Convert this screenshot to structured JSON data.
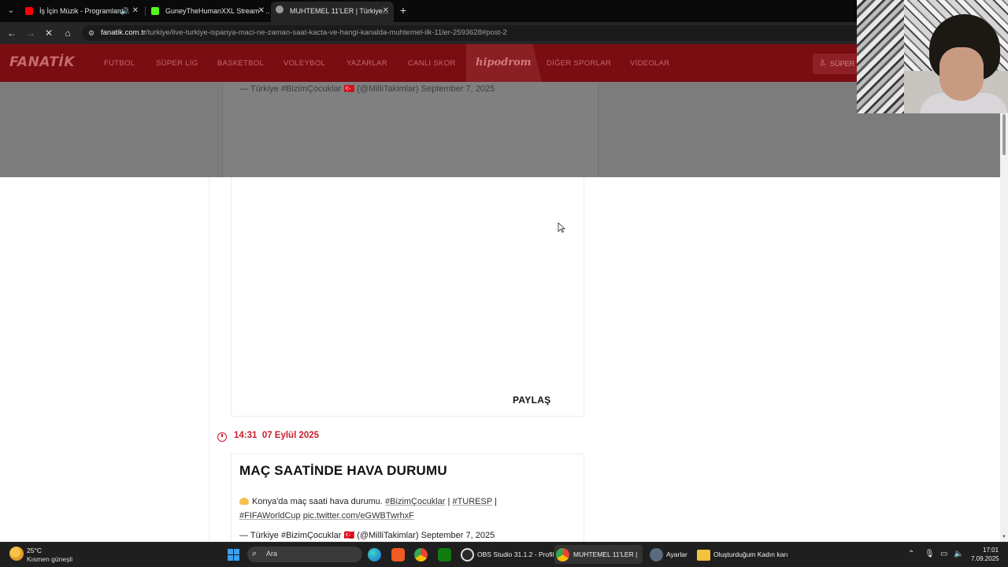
{
  "browser": {
    "tabs": [
      {
        "title": "İş İçin Müzik - Programlam...",
        "favicon_color": "#ff0000",
        "audio": true,
        "active": false
      },
      {
        "title": "GuneyTheHumanXXL Stream - ...",
        "favicon_color": "#53fc18",
        "audio": false,
        "active": false
      },
      {
        "title": "MUHTEMEL 11'LER | Türkiye...",
        "favicon_color": "#9a9a9a",
        "audio": false,
        "active": true
      }
    ],
    "new_tab_icon": "plus-icon",
    "url_host": "fanatik.com.tr",
    "url_path": "/turkiye/live-turkiye-ispanya-maci-ne-zaman-saat-kacta-ve-hangi-kanalda-muhtemel-ilk-11ler-2593628#post-2"
  },
  "site": {
    "logo": "FANATİK",
    "nav": [
      "FUTBOL",
      "SÜPER LİG",
      "BASKETBOL",
      "VOLEYBOL",
      "YAZARLAR",
      "CANLI SKOR"
    ],
    "hipodrom": "hipodrom",
    "nav_right": [
      "DİĞER SPORLAR",
      "VİDEOLAR"
    ],
    "super_button": "SÜPER",
    "brand_color": "#c81e2b"
  },
  "content": {
    "dim_quote": "— Türkiye #BizimÇocuklar 🇹🇷 (@MilliTakimlar) September 7, 2025",
    "share_label": "PAYLAŞ",
    "post_time": "14:31",
    "post_date": "07 Eylül 2025",
    "headline": "MAÇ SAATİNDE HAVA DURUMU",
    "body_text": "Konya'da maç saati hava durumu.",
    "body_tags_1": [
      "#BizimÇocuklar",
      "#TURESP"
    ],
    "body_tags_2": [
      "#FIFAWorldCup",
      "pic.twitter.com/eGWBTwrhxF"
    ],
    "separator": "|",
    "quote": "— Türkiye #BizimÇocuklar 🇹🇷 (@MilliTakimlar) September 7, 2025"
  },
  "taskbar": {
    "weather_temp": "25°C",
    "weather_desc": "Kısmen güneşli",
    "search_label": "Ara",
    "apps": [
      {
        "label": "OBS Studio 31.1.2 - Profil",
        "icon": "obs-icon"
      },
      {
        "label": "MUHTEMEL 11'LER |",
        "icon": "chrome-icon"
      },
      {
        "label": "Ayarlar",
        "icon": "gear-icon"
      },
      {
        "label": "Oluşturduğum Kadın karı",
        "icon": "folder-icon"
      }
    ],
    "time": "17:01",
    "date": "7.09.2025"
  }
}
